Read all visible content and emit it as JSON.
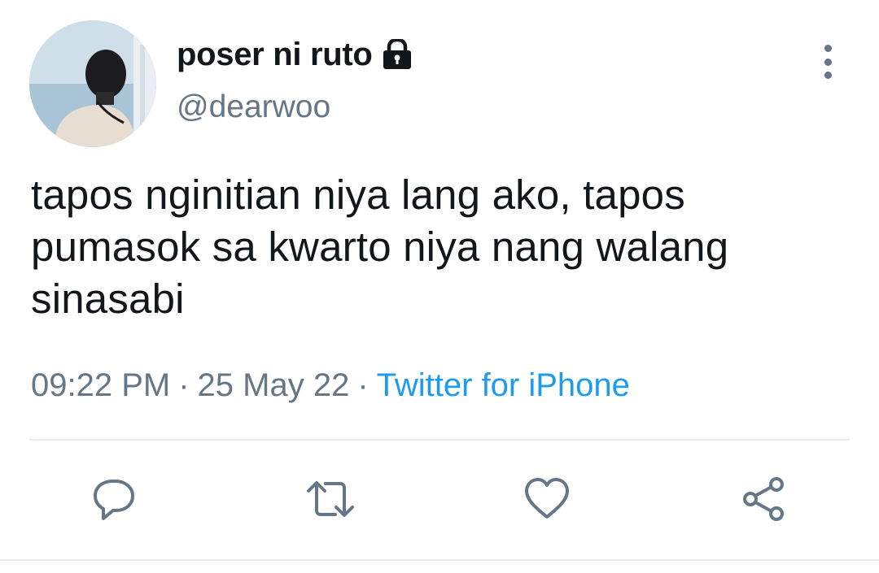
{
  "tweet": {
    "author": {
      "display_name": "poser ni ruto",
      "handle": "@dearwoo",
      "protected": true
    },
    "text": "tapos nginitian niya lang ako, tapos pumasok sa kwarto niya nang walang sinasabi",
    "time": "09:22 PM",
    "separator": "·",
    "date": "25 May 22",
    "source": "Twitter for iPhone"
  },
  "actions": [
    {
      "name": "reply",
      "icon": "reply-icon"
    },
    {
      "name": "retweet",
      "icon": "retweet-icon"
    },
    {
      "name": "like",
      "icon": "heart-icon"
    },
    {
      "name": "share",
      "icon": "share-icon"
    }
  ],
  "colors": {
    "text": "#14171a",
    "secondary": "#657786",
    "link": "#1d9bf0",
    "divider": "#e6ecf0"
  }
}
